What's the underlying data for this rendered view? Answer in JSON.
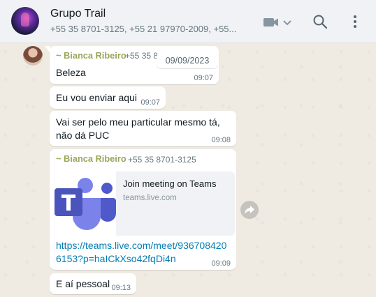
{
  "header": {
    "title": "Grupo Trail",
    "members": "+55 35 8701-3125, +55 21 97970-2009, +55..."
  },
  "date_pill": "09/09/2023",
  "messages": [
    {
      "sender": "~ Bianca Ribeiro",
      "phone": "+55 35 8701-3125",
      "text": "Beleza",
      "time": "09:07"
    },
    {
      "text": "Eu vou enviar aqui",
      "time": "09:07"
    },
    {
      "text_line1": "Vai ser pelo meu particular mesmo tá,",
      "text_line2": "não dá PUC",
      "time": "09:08"
    },
    {
      "sender": "~ Bianca Ribeiro",
      "phone": "+55 35 8701-3125",
      "preview_title": "Join meeting on Teams",
      "preview_domain": "teams.live.com",
      "link_line1": "https://teams.live.com/meet/936708420",
      "link_line2": "6153?p=haICkXso42fqDi4n",
      "time": "09:09"
    },
    {
      "text": "E aí pessoal",
      "time": "09:13"
    }
  ],
  "colors": {
    "header_bg": "#f0f2f5",
    "chat_bg": "#efeae2",
    "bubble_bg": "#ffffff",
    "sender_name": "#9ba75a",
    "link": "#027eb5",
    "teams_purple": "#5059c9"
  },
  "icons": [
    "video-call-icon",
    "chevron-down-icon",
    "search-icon",
    "menu-icon",
    "forward-icon"
  ]
}
